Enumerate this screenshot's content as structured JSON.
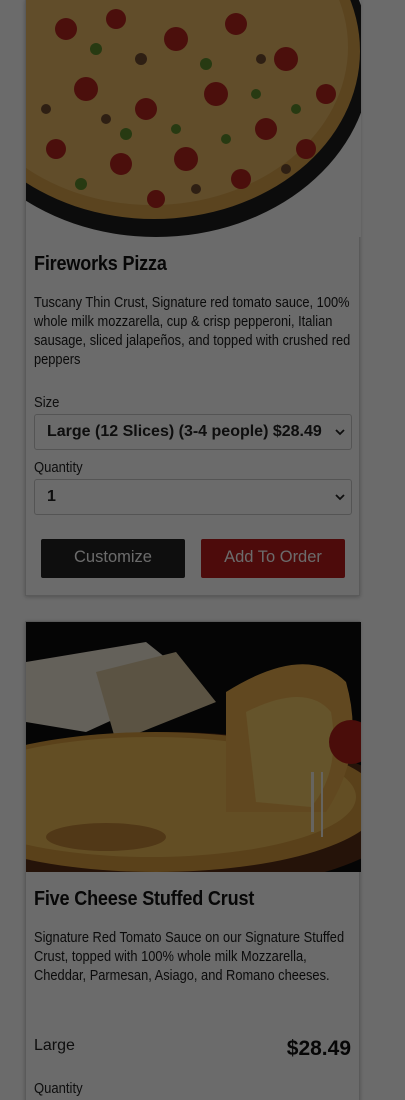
{
  "products": [
    {
      "name": "Fireworks Pizza",
      "description": "Tuscany Thin Crust, Signature red tomato sauce, 100% whole milk mozzarella, cup & crisp pepperoni, Italian sausage, sliced jalapeños, and topped with crushed red peppers",
      "size_label": "Size",
      "size_selected": "Large (12 Slices) (3-4 people) $28.49",
      "quantity_label": "Quantity",
      "quantity_selected": "1",
      "customize_label": "Customize",
      "add_to_order_label": "Add To Order"
    },
    {
      "name": "Five Cheese Stuffed Crust",
      "description": "Signature Red Tomato Sauce on our Signature Stuffed Crust, topped with 100% whole milk Mozzarella, Cheddar, Parmesan, Asiago, and Romano cheeses.",
      "size_text": "Large",
      "price": "$28.49",
      "quantity_label": "Quantity"
    }
  ],
  "colors": {
    "add_to_order": "#b71c1c",
    "customize": "#222222",
    "overlay": "rgba(0,0,0,0.58)"
  },
  "icons": [
    "chevron-down-icon"
  ]
}
